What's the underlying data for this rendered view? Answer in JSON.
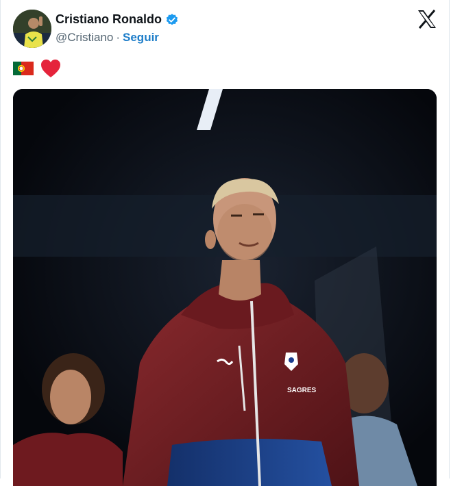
{
  "author": {
    "display_name": "Cristiano Ronaldo",
    "handle": "@Cristiano",
    "separator": "·",
    "follow_label": "Seguir",
    "verified_badge": "verified-badge-icon",
    "avatar": "avatar"
  },
  "brand": {
    "logo": "x-logo-icon"
  },
  "tweet": {
    "emojis": [
      "portugal-flag-icon",
      "red-heart-icon"
    ]
  },
  "media": {
    "shirt_brand_text": "SAGRES"
  },
  "colors": {
    "accent": "#1d7dc9",
    "verified": "#1d9bf0",
    "text_primary": "#0f1419",
    "text_secondary": "#536471",
    "heart": "#f91880",
    "hoodie": "#7a1f24"
  }
}
